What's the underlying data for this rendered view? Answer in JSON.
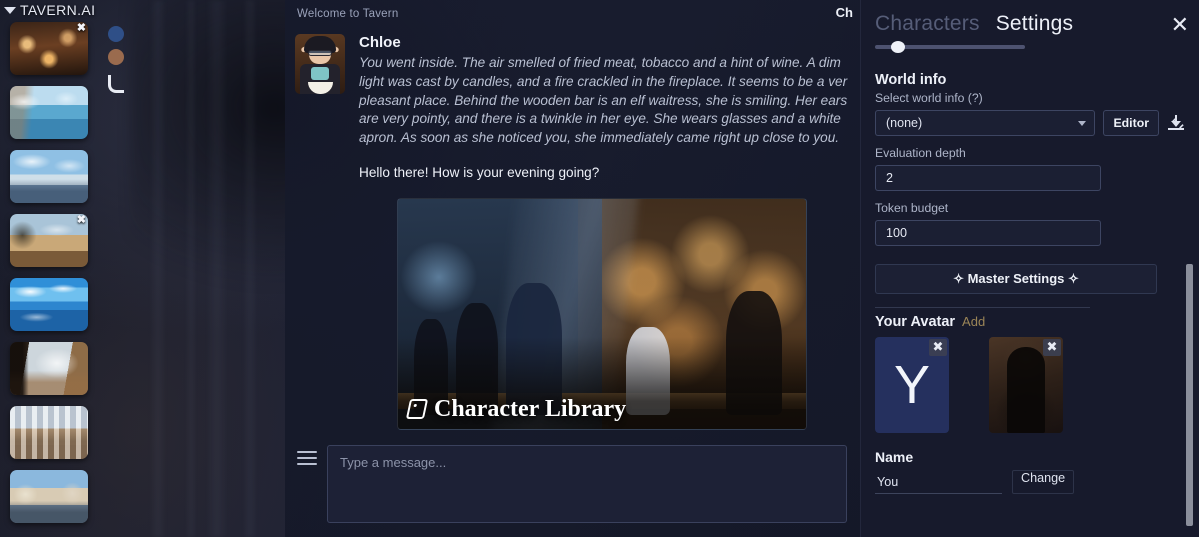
{
  "app": {
    "logo": "TAVERN.AI"
  },
  "sidebar": {
    "thumbnails": [
      {
        "name": "tavern-interior-night",
        "close_label": "✖"
      },
      {
        "name": "coastal-village-summer",
        "close_label": ""
      },
      {
        "name": "harbor-town-day",
        "close_label": ""
      },
      {
        "name": "countryside-road",
        "close_label": "✖"
      },
      {
        "name": "blue-sky-lake",
        "close_label": ""
      },
      {
        "name": "window-winter-room",
        "close_label": ""
      },
      {
        "name": "sunlit-cafe-interior",
        "close_label": ""
      },
      {
        "name": "european-street",
        "close_label": ""
      }
    ],
    "swatches": [
      {
        "name": "color-blue",
        "color": "#2f4f87"
      },
      {
        "name": "color-brown",
        "color": "#9a6b4e"
      }
    ]
  },
  "chat": {
    "welcome": "Welcome to Tavern",
    "character_name_truncated": "Ch",
    "message": {
      "author": "Chloe",
      "narration_lines": [
        "You went inside. The air smelled of fried meat, tobacco and a hint of wine. A dim",
        "light was cast by candles, and a fire crackled in the fireplace. It seems to be a ver",
        "pleasant place. Behind the wooden bar is an elf waitress, she is smiling. Her ears",
        "are very pointy, and there is a twinkle in her eye. She wears glasses and a white",
        "apron. As soon as she noticed you, she immediately came right up close to you."
      ],
      "dialogue": "Hello there! How is your evening going?"
    },
    "hero_card_label": "Character Library",
    "composer_placeholder": "Type a message...",
    "composer_value": ""
  },
  "settings": {
    "tab_characters": "Characters",
    "tab_settings": "Settings",
    "close_label": "✕",
    "world_info": {
      "title": "World info",
      "select_label": "Select world info (?)",
      "selected_value": "(none)",
      "editor_button": "Editor",
      "download_icon": "download-icon"
    },
    "evaluation_depth": {
      "label": "Evaluation depth",
      "value": "2"
    },
    "token_budget": {
      "label": "Token budget",
      "value": "100"
    },
    "master_settings_button": "✧ Master Settings ✧",
    "avatar": {
      "title": "Your Avatar",
      "add_link": "Add",
      "items": [
        {
          "name": "avatar-letter-y",
          "letter": "Y",
          "delete_label": "✖"
        },
        {
          "name": "avatar-photo",
          "letter": "",
          "delete_label": "✖"
        }
      ]
    },
    "name": {
      "label": "Name",
      "value": "You",
      "placeholder": "",
      "change_button": "Change"
    }
  }
}
